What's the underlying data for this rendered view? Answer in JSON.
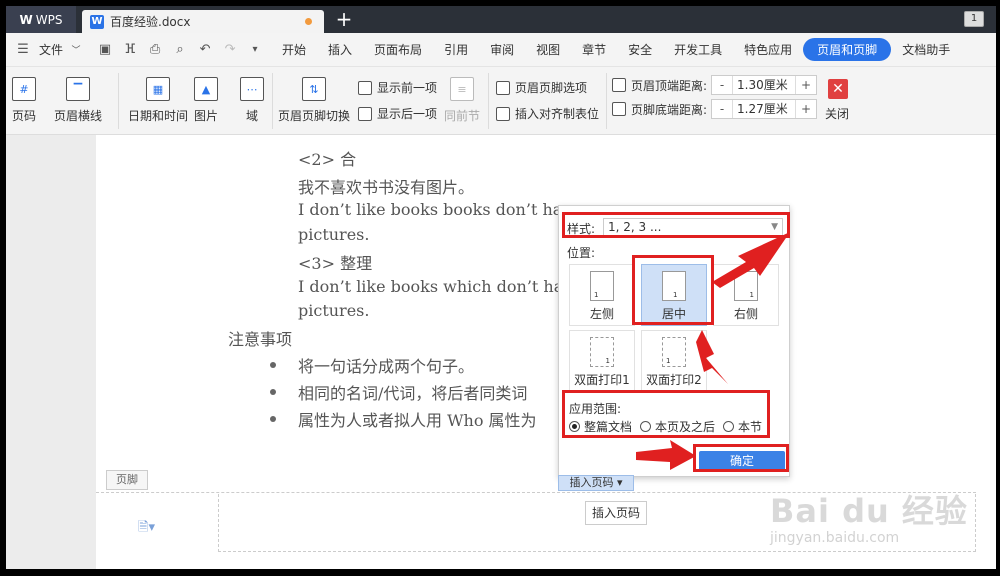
{
  "titlebar": {
    "brand": "WPS",
    "doc_name": "百度经验.docx",
    "new_tab": "+",
    "page_badge": "1"
  },
  "menubar": {
    "file": "文件",
    "tabs": [
      "开始",
      "插入",
      "页面布局",
      "引用",
      "审阅",
      "视图",
      "章节",
      "安全",
      "开发工具",
      "特色应用",
      "页眉和页脚",
      "文档助手"
    ],
    "active_tab": "页眉和页脚"
  },
  "ribbon": {
    "page_number": "页码",
    "header_line": "页眉横线",
    "date_time": "日期和时间",
    "picture": "图片",
    "field": "域",
    "switch": "页眉页脚切换",
    "show_prev": "显示前一项",
    "show_next": "显示后一项",
    "same_section": "同前节",
    "hf_options": "页眉页脚选项",
    "insert_align_tab": "插入对齐制表位",
    "header_top_label": "页眉顶端距离:",
    "header_top_value": "1.30厘米",
    "footer_bottom_label": "页脚底端距离:",
    "footer_bottom_value": "1.27厘米",
    "minus": "-",
    "plus": "+",
    "close": "关闭"
  },
  "document": {
    "lines": [
      "<2> 合",
      "我不喜欢书书没有图片。",
      "I don’t like books books don’t have",
      "pictures.",
      "<3> 整理",
      "I don’t like books which don’t have",
      "pictures."
    ],
    "notes_title": "注意事项",
    "bullets": [
      "将一句话分成两个句子。",
      "相同的名词/代词，将后者同类词",
      "属性为人或者拟人用 Who 属性为"
    ],
    "footer_tag": "页脚",
    "insert_page_number": "插入页码"
  },
  "popup": {
    "style_label": "样式:",
    "style_value": "1, 2, 3 ...",
    "position_label": "位置:",
    "positions": [
      "左侧",
      "居中",
      "右侧",
      "双面打印1",
      "双面打印2"
    ],
    "selected_position": "居中",
    "mini_num": "1",
    "scope_label": "应用范围:",
    "scope_options": [
      "整篇文档",
      "本页及之后",
      "本节"
    ],
    "ok": "确定",
    "tab_label": "插入页码"
  },
  "watermark": {
    "main": "Bai du 经验",
    "sub": "jingyan.baidu.com"
  },
  "colors": {
    "accent": "#2a73e8",
    "annotation": "#e02020",
    "selected_tile": "#cfe0f7",
    "close": "#e04040"
  }
}
